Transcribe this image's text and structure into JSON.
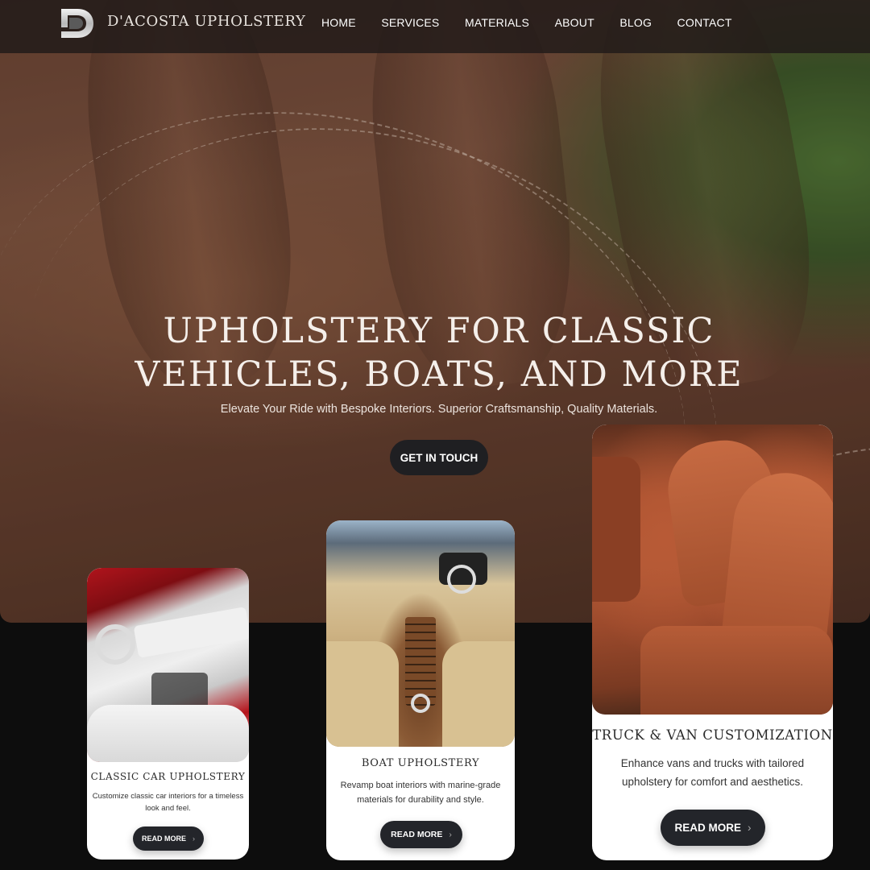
{
  "brand": {
    "name": "D'ACOSTA UPHOLSTERY",
    "logo_letter": "D"
  },
  "nav": {
    "items": [
      {
        "label": "HOME"
      },
      {
        "label": "SERVICES"
      },
      {
        "label": "MATERIALS"
      },
      {
        "label": "ABOUT"
      },
      {
        "label": "BLOG"
      },
      {
        "label": "CONTACT"
      }
    ]
  },
  "hero": {
    "title_line1": "UPHOLSTERY FOR CLASSIC",
    "title_line2": "VEHICLES, BOATS, AND MORE",
    "subtitle": "Elevate Your Ride with Bespoke Interiors. Superior Craftsmanship, Quality Materials.",
    "cta_label": "GET IN TOUCH"
  },
  "cards": [
    {
      "title": "CLASSIC CAR UPHOLSTERY",
      "description": "Customize classic car interiors for a timeless look and feel.",
      "button_label": "READ MORE"
    },
    {
      "title": "BOAT UPHOLSTERY",
      "description": "Revamp boat interiors with marine-grade materials for durability and style.",
      "button_label": "READ MORE"
    },
    {
      "title": "TRUCK & VAN CUSTOMIZATION",
      "description": "Enhance vans and trucks with tailored upholstery for comfort and aesthetics.",
      "button_label": "READ MORE"
    }
  ],
  "colors": {
    "nav_bg": "#201a18",
    "button_dark": "#23252a",
    "page_bg": "#0d0d0d",
    "card_bg": "#ffffff"
  }
}
